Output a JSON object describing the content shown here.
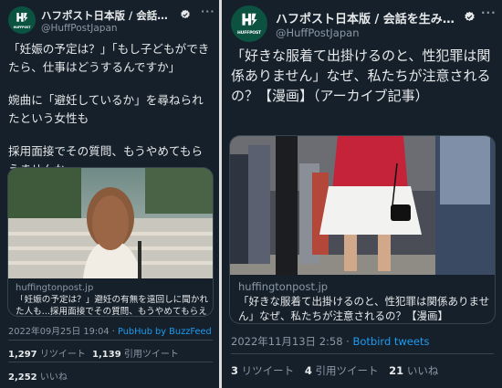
{
  "left_tweet": {
    "account": {
      "display_name": "ハフポスト日本版 / 会話を生み出す...",
      "handle": "@HuffPostJapan",
      "avatar_text": "HUFFPOST",
      "verified_icon": "verified-badge-icon",
      "more_icon": "more-options-icon",
      "more_symbol": "···"
    },
    "text_lines": [
      "「妊娠の予定は？」「もし子どもができたら、仕事はどうするんですか」",
      "婉曲に「避妊しているか」を尋ねられたという女性も",
      "採用面接でその質問、もうやめてもらえませんか"
    ],
    "card": {
      "domain": "huffingtonpost.jp",
      "title": "「妊娠の予定は？」避妊の有無を遠回しに聞かれた人も...採用面接でその質問、もうやめてもらえま..."
    },
    "timestamp": "2022年09月25日 19:04",
    "separator": "·",
    "source": "PubHub by BuzzFeed",
    "retweets": {
      "count": "1,297",
      "label": "リツイート"
    },
    "quotes": {
      "count": "1,139",
      "label": "引用ツイート"
    },
    "likes": {
      "count": "2,252",
      "label": "いいね"
    }
  },
  "right_tweet": {
    "account": {
      "display_name": "ハフポスト日本版 / 会話を生み出す...",
      "handle": "@HuffPostJapan",
      "avatar_text": "HUFFPOST",
      "verified_icon": "verified-badge-icon",
      "more_icon": "more-options-icon",
      "more_symbol": "···"
    },
    "text": "「好きな服着て出掛けるのと、性犯罪は関係ありません」なぜ、私たちが注意されるの？【漫画】（アーカイブ記事）",
    "card": {
      "domain": "huffingtonpost.jp",
      "title": "「好きな服着て出掛けるのと、性犯罪は関係ありません」なぜ、私たちが注意されるの？【漫画】"
    },
    "timestamp": "2022年11月13日 2:58",
    "separator": "·",
    "source": "Botbird tweets",
    "retweets": {
      "count": "3",
      "label": "リツイート"
    },
    "quotes": {
      "count": "4",
      "label": "引用ツイート"
    },
    "likes": {
      "count": "21",
      "label": "いいね"
    }
  },
  "colors": {
    "background": "#15202b",
    "text": "#e7e9ea",
    "secondary_text": "#8b98a5",
    "link": "#1d9bf0",
    "border": "#38444d",
    "avatar_green": "#0b5340"
  }
}
